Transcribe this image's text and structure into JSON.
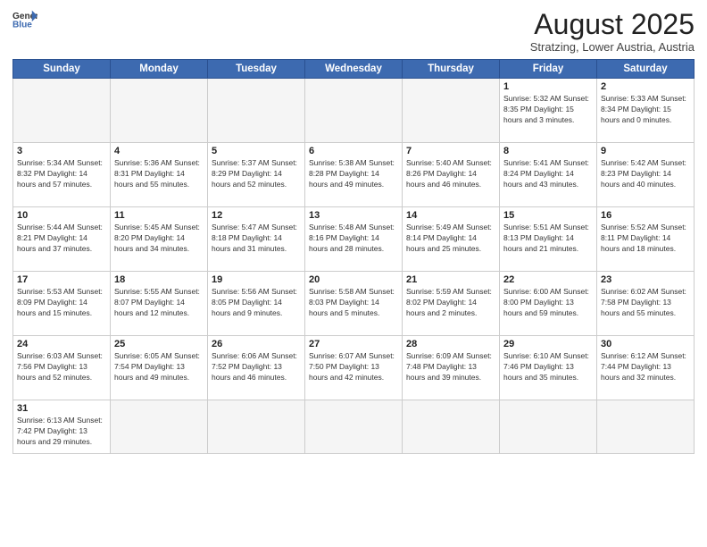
{
  "header": {
    "logo_general": "General",
    "logo_blue": "Blue",
    "title": "August 2025",
    "subtitle": "Stratzing, Lower Austria, Austria"
  },
  "days_of_week": [
    "Sunday",
    "Monday",
    "Tuesday",
    "Wednesday",
    "Thursday",
    "Friday",
    "Saturday"
  ],
  "weeks": [
    [
      {
        "day": "",
        "info": ""
      },
      {
        "day": "",
        "info": ""
      },
      {
        "day": "",
        "info": ""
      },
      {
        "day": "",
        "info": ""
      },
      {
        "day": "",
        "info": ""
      },
      {
        "day": "1",
        "info": "Sunrise: 5:32 AM\nSunset: 8:35 PM\nDaylight: 15 hours and 3 minutes."
      },
      {
        "day": "2",
        "info": "Sunrise: 5:33 AM\nSunset: 8:34 PM\nDaylight: 15 hours and 0 minutes."
      }
    ],
    [
      {
        "day": "3",
        "info": "Sunrise: 5:34 AM\nSunset: 8:32 PM\nDaylight: 14 hours and 57 minutes."
      },
      {
        "day": "4",
        "info": "Sunrise: 5:36 AM\nSunset: 8:31 PM\nDaylight: 14 hours and 55 minutes."
      },
      {
        "day": "5",
        "info": "Sunrise: 5:37 AM\nSunset: 8:29 PM\nDaylight: 14 hours and 52 minutes."
      },
      {
        "day": "6",
        "info": "Sunrise: 5:38 AM\nSunset: 8:28 PM\nDaylight: 14 hours and 49 minutes."
      },
      {
        "day": "7",
        "info": "Sunrise: 5:40 AM\nSunset: 8:26 PM\nDaylight: 14 hours and 46 minutes."
      },
      {
        "day": "8",
        "info": "Sunrise: 5:41 AM\nSunset: 8:24 PM\nDaylight: 14 hours and 43 minutes."
      },
      {
        "day": "9",
        "info": "Sunrise: 5:42 AM\nSunset: 8:23 PM\nDaylight: 14 hours and 40 minutes."
      }
    ],
    [
      {
        "day": "10",
        "info": "Sunrise: 5:44 AM\nSunset: 8:21 PM\nDaylight: 14 hours and 37 minutes."
      },
      {
        "day": "11",
        "info": "Sunrise: 5:45 AM\nSunset: 8:20 PM\nDaylight: 14 hours and 34 minutes."
      },
      {
        "day": "12",
        "info": "Sunrise: 5:47 AM\nSunset: 8:18 PM\nDaylight: 14 hours and 31 minutes."
      },
      {
        "day": "13",
        "info": "Sunrise: 5:48 AM\nSunset: 8:16 PM\nDaylight: 14 hours and 28 minutes."
      },
      {
        "day": "14",
        "info": "Sunrise: 5:49 AM\nSunset: 8:14 PM\nDaylight: 14 hours and 25 minutes."
      },
      {
        "day": "15",
        "info": "Sunrise: 5:51 AM\nSunset: 8:13 PM\nDaylight: 14 hours and 21 minutes."
      },
      {
        "day": "16",
        "info": "Sunrise: 5:52 AM\nSunset: 8:11 PM\nDaylight: 14 hours and 18 minutes."
      }
    ],
    [
      {
        "day": "17",
        "info": "Sunrise: 5:53 AM\nSunset: 8:09 PM\nDaylight: 14 hours and 15 minutes."
      },
      {
        "day": "18",
        "info": "Sunrise: 5:55 AM\nSunset: 8:07 PM\nDaylight: 14 hours and 12 minutes."
      },
      {
        "day": "19",
        "info": "Sunrise: 5:56 AM\nSunset: 8:05 PM\nDaylight: 14 hours and 9 minutes."
      },
      {
        "day": "20",
        "info": "Sunrise: 5:58 AM\nSunset: 8:03 PM\nDaylight: 14 hours and 5 minutes."
      },
      {
        "day": "21",
        "info": "Sunrise: 5:59 AM\nSunset: 8:02 PM\nDaylight: 14 hours and 2 minutes."
      },
      {
        "day": "22",
        "info": "Sunrise: 6:00 AM\nSunset: 8:00 PM\nDaylight: 13 hours and 59 minutes."
      },
      {
        "day": "23",
        "info": "Sunrise: 6:02 AM\nSunset: 7:58 PM\nDaylight: 13 hours and 55 minutes."
      }
    ],
    [
      {
        "day": "24",
        "info": "Sunrise: 6:03 AM\nSunset: 7:56 PM\nDaylight: 13 hours and 52 minutes."
      },
      {
        "day": "25",
        "info": "Sunrise: 6:05 AM\nSunset: 7:54 PM\nDaylight: 13 hours and 49 minutes."
      },
      {
        "day": "26",
        "info": "Sunrise: 6:06 AM\nSunset: 7:52 PM\nDaylight: 13 hours and 46 minutes."
      },
      {
        "day": "27",
        "info": "Sunrise: 6:07 AM\nSunset: 7:50 PM\nDaylight: 13 hours and 42 minutes."
      },
      {
        "day": "28",
        "info": "Sunrise: 6:09 AM\nSunset: 7:48 PM\nDaylight: 13 hours and 39 minutes."
      },
      {
        "day": "29",
        "info": "Sunrise: 6:10 AM\nSunset: 7:46 PM\nDaylight: 13 hours and 35 minutes."
      },
      {
        "day": "30",
        "info": "Sunrise: 6:12 AM\nSunset: 7:44 PM\nDaylight: 13 hours and 32 minutes."
      }
    ],
    [
      {
        "day": "31",
        "info": "Sunrise: 6:13 AM\nSunset: 7:42 PM\nDaylight: 13 hours and 29 minutes."
      },
      {
        "day": "",
        "info": ""
      },
      {
        "day": "",
        "info": ""
      },
      {
        "day": "",
        "info": ""
      },
      {
        "day": "",
        "info": ""
      },
      {
        "day": "",
        "info": ""
      },
      {
        "day": "",
        "info": ""
      }
    ]
  ]
}
